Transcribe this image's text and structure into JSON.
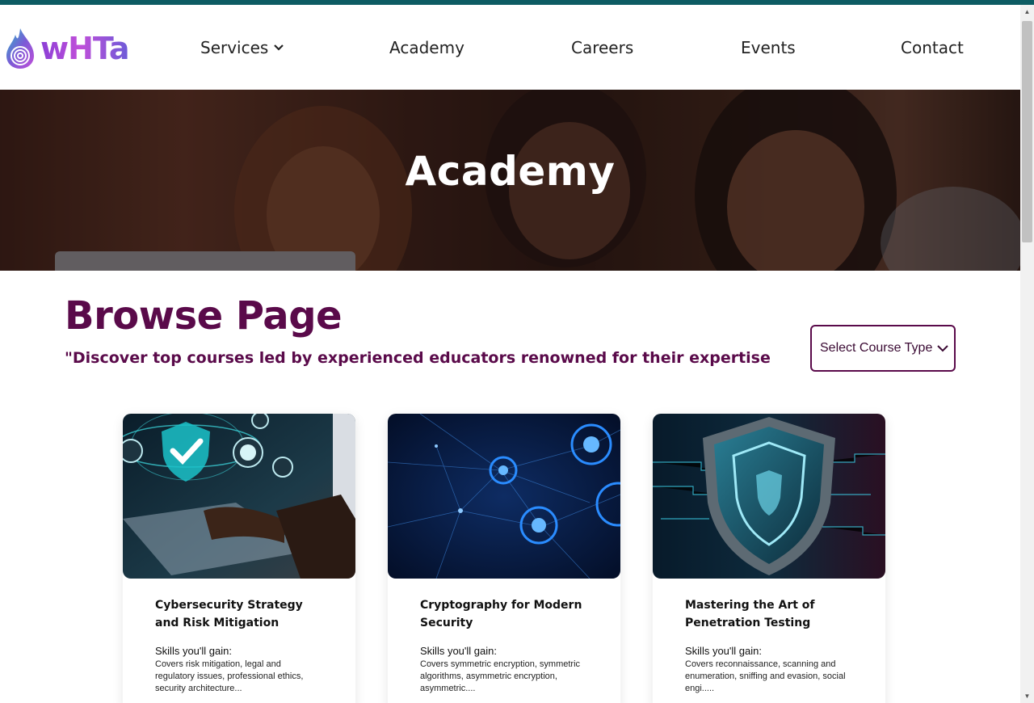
{
  "brand": {
    "logo_text": "wHTa"
  },
  "nav": {
    "services": "Services",
    "academy": "Academy",
    "careers": "Careers",
    "events": "Events",
    "contact": "Contact"
  },
  "hero": {
    "title": "Academy"
  },
  "browse": {
    "title": "Browse Page",
    "subtitle": "\"Discover top courses led by experienced educators renowned for their expertise",
    "select_label": "Select Course Type"
  },
  "courses": [
    {
      "title": "Cybersecurity Strategy and Risk Mitigation",
      "skills_label": "Skills you'll gain:",
      "skills": "Covers risk mitigation, legal and regulatory issues, professional ethics, security architecture..."
    },
    {
      "title": "Cryptography for Modern Security",
      "skills_label": "Skills you'll gain:",
      "skills": "Covers symmetric encryption, symmetric algorithms, asymmetric encryption, asymmetric...."
    },
    {
      "title": "Mastering the Art of Penetration Testing",
      "skills_label": "Skills you'll gain:",
      "skills": "Covers reconnaissance, scanning and enumeration, sniffing and evasion, social engi....."
    }
  ],
  "colors": {
    "top_bar": "#0d5c63",
    "brand_purple": "#5a0a4a",
    "logo_gradient_start": "#8b3fd6",
    "logo_gradient_end": "#6c5bd8"
  },
  "icons": {
    "logo": "flame-fingerprint-icon",
    "services_dropdown": "chevron-down-icon",
    "select_dropdown": "chevron-down-icon"
  }
}
